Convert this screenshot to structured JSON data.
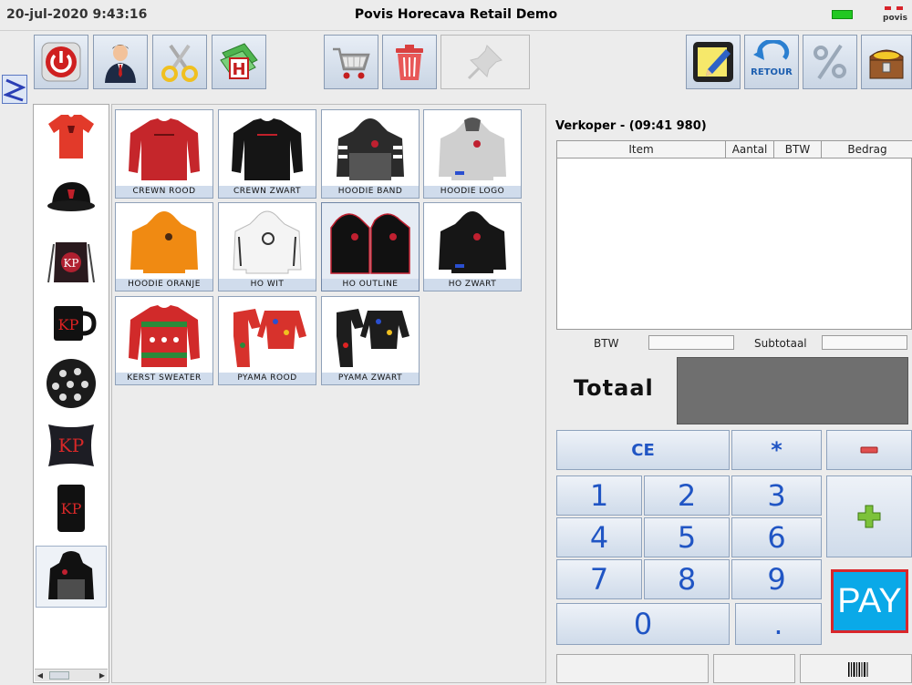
{
  "header": {
    "datetime": "20-jul-2020  9:43:16",
    "title": "Povis Horecava Retail Demo",
    "logo_text": "povis",
    "status_led_color": "#22c822"
  },
  "toolbar": {
    "left_icons": [
      "power-icon",
      "waiter-icon",
      "scissors-icon",
      "cash-h-icon"
    ],
    "middle_icons": [
      "shopping-cart-icon",
      "trash-icon",
      "pushpin-icon"
    ],
    "right_icons": [
      "edit-note-icon",
      "return-icon",
      "percent-icon",
      "treasure-chest-icon"
    ],
    "retour_label": "RETOUR"
  },
  "side_tab_icon": "zigzag-icon",
  "categories": [
    {
      "icon": "tshirt-icon"
    },
    {
      "icon": "cap-icon"
    },
    {
      "icon": "drawstring-bag-icon"
    },
    {
      "icon": "mug-icon"
    },
    {
      "icon": "ball-icon"
    },
    {
      "icon": "pillow-icon"
    },
    {
      "icon": "phone-case-icon"
    },
    {
      "icon": "hoodie-icon",
      "selected": true
    }
  ],
  "products": [
    {
      "label": "CREWN ROOD",
      "color": "#c5262b"
    },
    {
      "label": "CREWN ZWART",
      "color": "#151515"
    },
    {
      "label": "HOODIE BAND",
      "color": "#2b2b2b"
    },
    {
      "label": "HOODIE LOGO",
      "color": "#cfcfcf"
    },
    {
      "label": "HOODIE ORANJE",
      "color": "#f08a12"
    },
    {
      "label": "HO WIT",
      "color": "#f4f4f4"
    },
    {
      "label": "HO OUTLINE",
      "color": "#111111"
    },
    {
      "label": "HO ZWART",
      "color": "#161616"
    },
    {
      "label": "KERST SWEATER",
      "color": "#d12a2a"
    },
    {
      "label": "PYAMA ROOD",
      "color": "#d7322c"
    },
    {
      "label": "PYAMA ZWART",
      "color": "#1d1d1d"
    }
  ],
  "ticket": {
    "seller": "Verkoper - (09:41 980)",
    "columns": [
      "Item",
      "Aantal",
      "BTW",
      "Bedrag"
    ]
  },
  "summary": {
    "btw_label": "BTW",
    "subtotal_label": "Subtotaal",
    "total_label": "Totaal"
  },
  "keypad": {
    "ce": "CE",
    "star": "*",
    "digits": [
      "1",
      "2",
      "3",
      "4",
      "5",
      "6",
      "7",
      "8",
      "9",
      "0"
    ],
    "dot": ".",
    "minus_icon": "minus-icon",
    "plus_icon": "plus-icon",
    "pay": "PAY"
  }
}
